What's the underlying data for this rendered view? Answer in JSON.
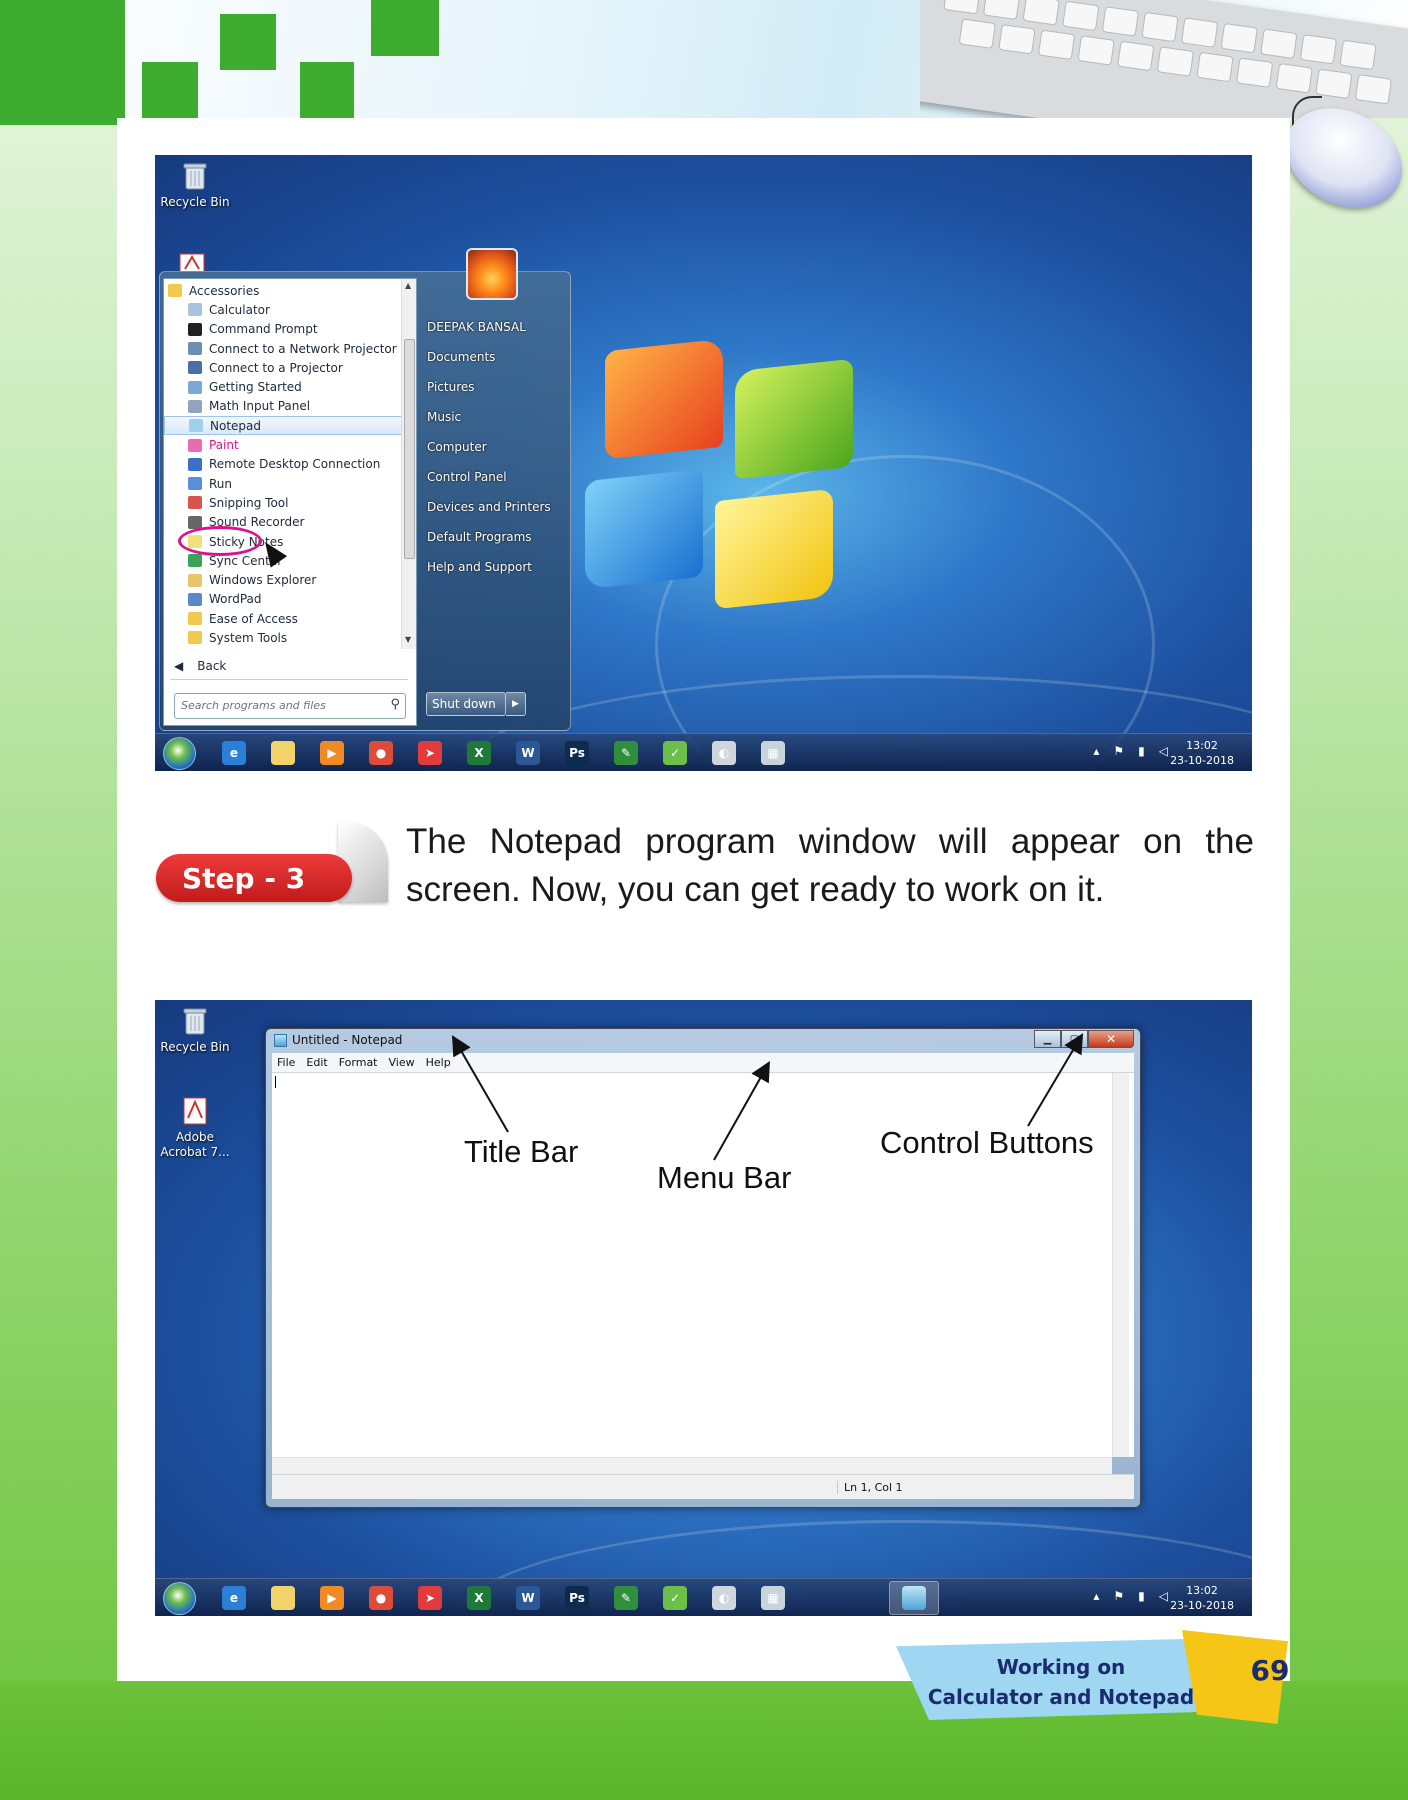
{
  "screenshot1": {
    "desktop": {
      "recycle_bin_label": "Recycle Bin"
    },
    "start_menu": {
      "programs": [
        {
          "label": "Accessories",
          "type": "folder"
        },
        {
          "label": "Calculator"
        },
        {
          "label": "Command Prompt"
        },
        {
          "label": "Connect to a Network Projector"
        },
        {
          "label": "Connect to a Projector"
        },
        {
          "label": "Getting Started"
        },
        {
          "label": "Math Input Panel"
        },
        {
          "label": "Notepad",
          "highlighted": true
        },
        {
          "label": "Paint"
        },
        {
          "label": "Remote Desktop Connection"
        },
        {
          "label": "Run"
        },
        {
          "label": "Snipping Tool"
        },
        {
          "label": "Sound Recorder"
        },
        {
          "label": "Sticky Notes"
        },
        {
          "label": "Sync Center"
        },
        {
          "label": "Windows Explorer"
        },
        {
          "label": "WordPad"
        },
        {
          "label": "Ease of Access",
          "type": "folder"
        },
        {
          "label": "System Tools",
          "type": "folder"
        }
      ],
      "back_label": "Back",
      "search_placeholder": "Search programs and files",
      "right_links": [
        "DEEPAK BANSAL",
        "Documents",
        "Pictures",
        "Music",
        "Computer",
        "Control Panel",
        "Devices and Printers",
        "Default Programs",
        "Help and Support"
      ],
      "shutdown_label": "Shut down"
    },
    "taskbar": {
      "time": "13:02",
      "date": "23-10-2018"
    }
  },
  "step": {
    "badge": "Step - 3",
    "text": "The Notepad program window will appear on the screen. Now, you can get ready to work on it."
  },
  "screenshot2": {
    "desktop": {
      "recycle_bin_label": "Recycle Bin",
      "acrobat_label_line1": "Adobe",
      "acrobat_label_line2": "Acrobat 7..."
    },
    "notepad": {
      "title": "Untitled - Notepad",
      "menu": [
        "File",
        "Edit",
        "Format",
        "View",
        "Help"
      ],
      "status": "Ln 1, Col 1"
    },
    "callouts": {
      "title_bar": "Title Bar",
      "menu_bar": "Menu Bar",
      "control_buttons": "Control Buttons"
    },
    "taskbar": {
      "time": "13:02",
      "date": "23-10-2018"
    }
  },
  "taskbar_icons": [
    {
      "name": "internet-explorer-icon",
      "glyph": "e",
      "color": "#2b7fd4"
    },
    {
      "name": "file-explorer-icon",
      "glyph": "",
      "color": "#f2d26b"
    },
    {
      "name": "media-player-icon",
      "glyph": "▶",
      "color": "#f08a24"
    },
    {
      "name": "chrome-icon",
      "glyph": "●",
      "color": "#dd4b39"
    },
    {
      "name": "paper-plane-icon",
      "glyph": "➤",
      "color": "#e23b3b"
    },
    {
      "name": "excel-icon",
      "glyph": "X",
      "color": "#1f7a3a"
    },
    {
      "name": "word-icon",
      "glyph": "W",
      "color": "#2b5797"
    },
    {
      "name": "photoshop-icon",
      "glyph": "Ps",
      "color": "#0d2b4f"
    },
    {
      "name": "paint-icon",
      "glyph": "✎",
      "color": "#2f8f3a"
    },
    {
      "name": "notepad-plus-icon",
      "glyph": "✓",
      "color": "#6cc04a"
    },
    {
      "name": "controller-icon",
      "glyph": "◐",
      "color": "#cfd6dd"
    },
    {
      "name": "calculator-icon",
      "glyph": "▦",
      "color": "#c8d3dc"
    }
  ],
  "footer": {
    "chapter_line1": "Working on",
    "chapter_line2": "Calculator and Notepad",
    "page_number": "69"
  }
}
